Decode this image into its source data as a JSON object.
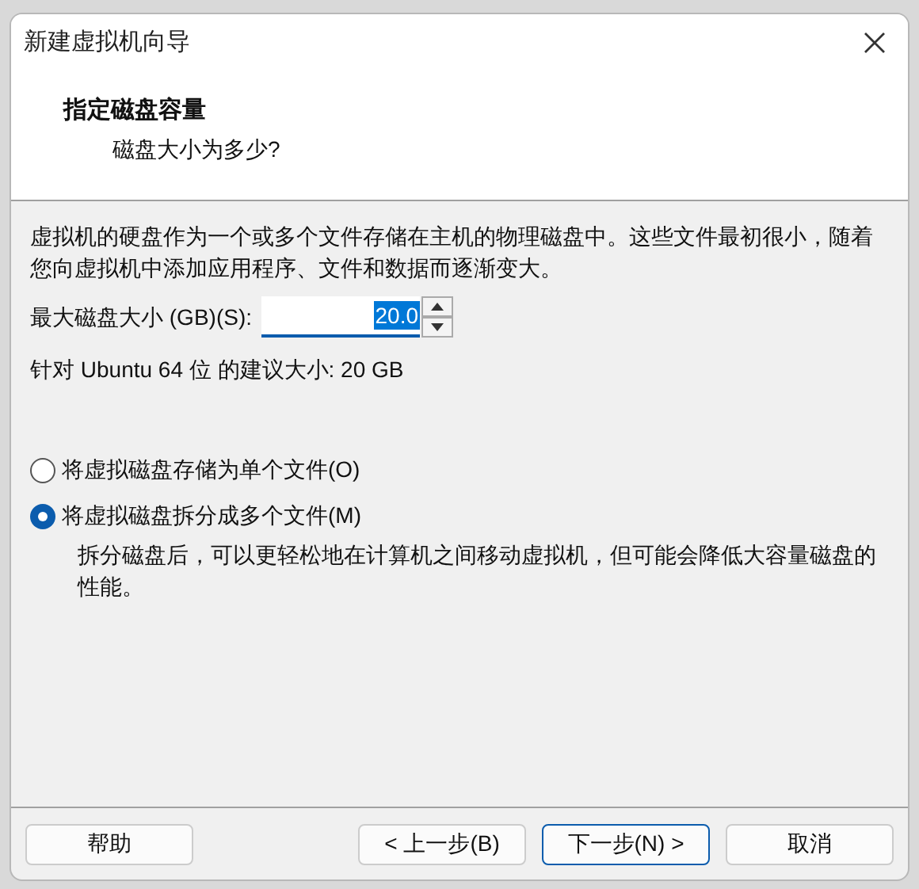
{
  "window": {
    "title": "新建虚拟机向导"
  },
  "header": {
    "title": "指定磁盘容量",
    "subtitle": "磁盘大小为多少?"
  },
  "description": "虚拟机的硬盘作为一个或多个文件存储在主机的物理磁盘中。这些文件最初很小，随着您向虚拟机中添加应用程序、文件和数据而逐渐变大。",
  "disk_size": {
    "label": "最大磁盘大小 (GB)(S):",
    "value": "20.0"
  },
  "recommendation": "针对 Ubuntu 64 位 的建议大小: 20 GB",
  "options": [
    {
      "label": "将虚拟磁盘存储为单个文件(O)",
      "selected": false
    },
    {
      "label": "将虚拟磁盘拆分成多个文件(M)",
      "selected": true
    }
  ],
  "option_note": "拆分磁盘后，可以更轻松地在计算机之间移动虚拟机，但可能会降低大容量磁盘的性能。",
  "buttons": {
    "help": "帮助",
    "back": "< 上一步(B)",
    "next": "下一步(N) >",
    "cancel": "取消"
  }
}
